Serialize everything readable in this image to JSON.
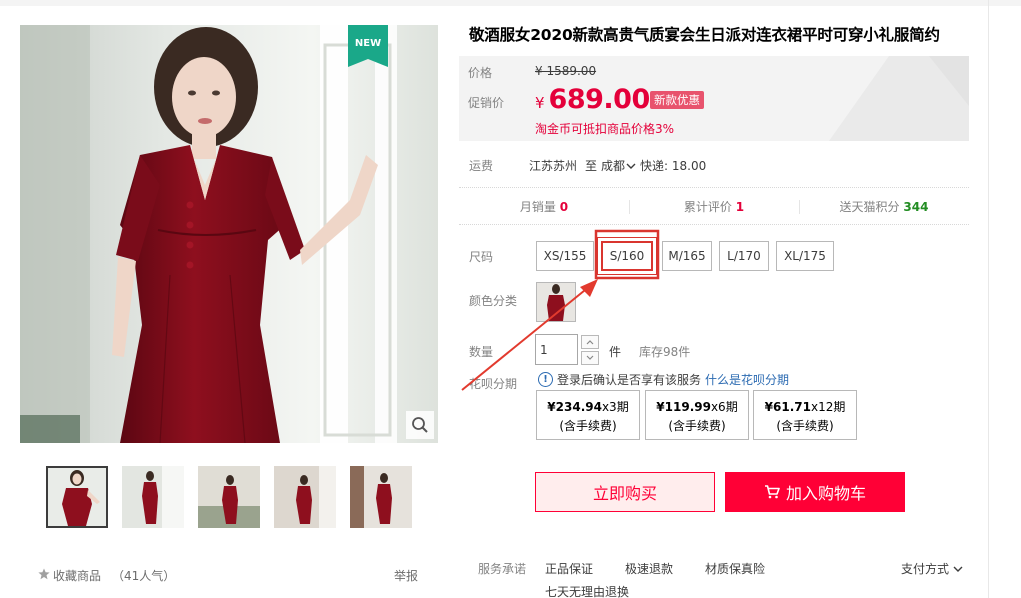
{
  "gallery": {
    "new_badge": "NEW",
    "favorite_label": "收藏商品",
    "favorite_count": "（41人气）",
    "report_label": "举报"
  },
  "product": {
    "title": "敬酒服女2020新款高贵气质宴会生日派对连衣裙平时可穿小礼服简约"
  },
  "price": {
    "orig_label": "价格",
    "orig_value": "¥ 1589.00",
    "promo_label": "促销价",
    "promo_currency": "¥",
    "promo_value": "689.00",
    "promo_tag": "新款优惠",
    "tmall_coin_note": "淘金币可抵扣商品价格3%"
  },
  "shipping": {
    "label": "运费",
    "from": "江苏苏州",
    "to_word": "至",
    "to": "成都",
    "express": "快递: 18.00"
  },
  "stats": {
    "monthly_sales_label": "月销量",
    "monthly_sales_value": "0",
    "reviews_label": "累计评价",
    "reviews_value": "1",
    "points_label": "送天猫积分",
    "points_value": "344"
  },
  "options": {
    "size_label": "尺码",
    "sizes": [
      "XS/155",
      "S/160",
      "M/165",
      "L/170",
      "XL/175"
    ],
    "selected_size": "S/160",
    "color_label": "颜色分类",
    "quantity_label": "数量",
    "quantity_value": "1",
    "quantity_unit": "件",
    "stock": "库存98件"
  },
  "huabei": {
    "label": "花呗分期",
    "info_text": "登录后确认是否享有该服务",
    "info_link": "什么是花呗分期",
    "plans": [
      {
        "amount": "¥234.94",
        "term": "x3期",
        "fee": "(含手续费)"
      },
      {
        "amount": "¥119.99",
        "term": "x6期",
        "fee": "(含手续费)"
      },
      {
        "amount": "¥61.71",
        "term": "x12期",
        "fee": "(含手续费)"
      }
    ]
  },
  "actions": {
    "buy_now": "立即购买",
    "add_to_cart": "加入购物车"
  },
  "service": {
    "label": "服务承诺",
    "items": [
      "正品保证",
      "极速退款",
      "材质保真险",
      "七天无理由退换"
    ],
    "payment_label": "支付方式"
  },
  "colors": {
    "accent": "#ff0036",
    "price_red": "#e4003a",
    "badge_green": "#1aa889",
    "dress_red": "#8e0f1e",
    "link_blue": "#2c6bb2"
  },
  "icons": [
    "zoom-icon",
    "star-icon",
    "info-icon",
    "cart-icon",
    "chevron-down-icon",
    "up-arrow-icon",
    "down-arrow-icon"
  ]
}
